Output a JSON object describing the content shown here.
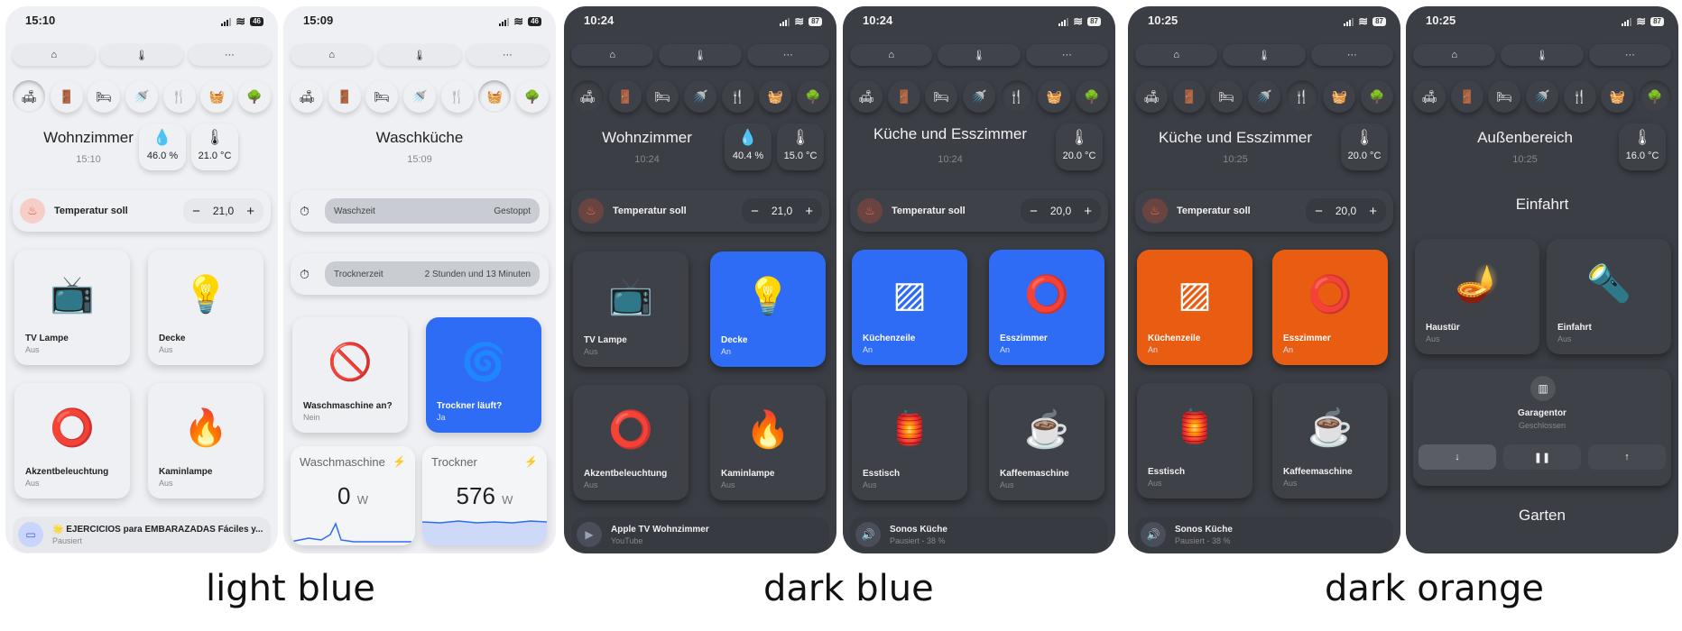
{
  "captions": {
    "light": "light blue",
    "dark_blue": "dark blue",
    "dark_orange": "dark orange"
  },
  "colors": {
    "accent_blue": "#2f6cf5",
    "accent_orange": "#e95d12",
    "light_bg": "#eef0f3",
    "dark_bg": "#3b3e45"
  },
  "nav": {
    "home_icon": "⌂",
    "thermo_icon": "🌡",
    "more_icon": "···"
  },
  "rooms_icons": [
    "sofa-icon",
    "door-icon",
    "bed-icon",
    "shower-icon",
    "cutlery-icon",
    "washer-icon",
    "tree-icon"
  ],
  "p1": {
    "time": "15:10",
    "battery": "46",
    "room": "Wohnzimmer",
    "room_time": "15:10",
    "humidity": "46.0 %",
    "temp": "21.0 °C",
    "thermo_label": "Temperatur soll",
    "thermo_value": "21,0",
    "tiles": [
      {
        "name": "TV Lampe",
        "state": "Aus"
      },
      {
        "name": "Decke",
        "state": "Aus"
      },
      {
        "name": "Akzentbeleuchtung",
        "state": "Aus"
      },
      {
        "name": "Kaminlampe",
        "state": "Aus"
      }
    ],
    "media_title": "🌟 EJERCICIOS para EMBARAZADAS Fáciles y...",
    "media_state": "Pausiert"
  },
  "p2": {
    "time": "15:09",
    "battery": "46",
    "room": "Waschküche",
    "room_time": "15:09",
    "timer1_label": "Waschzeit",
    "timer1_value": "Gestoppt",
    "timer2_label": "Trocknerzeit",
    "timer2_value": "2 Stunden und 13 Minuten",
    "tiles": [
      {
        "name": "Waschmaschine an?",
        "state": "Nein"
      },
      {
        "name": "Trockner läuft?",
        "state": "Ja"
      }
    ],
    "power": [
      {
        "name": "Waschmaschine",
        "value": "0",
        "unit": "W"
      },
      {
        "name": "Trockner",
        "value": "576",
        "unit": "W"
      }
    ]
  },
  "p3": {
    "time": "10:24",
    "battery": "87",
    "room": "Wohnzimmer",
    "room_time": "10:24",
    "humidity": "40.4 %",
    "temp": "15.0 °C",
    "thermo_label": "Temperatur soll",
    "thermo_value": "21,0",
    "tiles": [
      {
        "name": "TV Lampe",
        "state": "Aus"
      },
      {
        "name": "Decke",
        "state": "An"
      },
      {
        "name": "Akzentbeleuchtung",
        "state": "Aus"
      },
      {
        "name": "Kaminlampe",
        "state": "Aus"
      }
    ],
    "media_title": "Apple TV Wohnzimmer",
    "media_state": "YouTube"
  },
  "p4": {
    "time": "10:24",
    "battery": "87",
    "room": "Küche und Esszimmer",
    "room_time": "10:24",
    "temp": "20.0 °C",
    "thermo_label": "Temperatur soll",
    "thermo_value": "20,0",
    "tiles": [
      {
        "name": "Küchenzeile",
        "state": "An"
      },
      {
        "name": "Esszimmer",
        "state": "An"
      },
      {
        "name": "Esstisch",
        "state": "Aus"
      },
      {
        "name": "Kaffeemaschine",
        "state": "Aus"
      }
    ],
    "media_title": "Sonos Küche",
    "media_state": "Pausiert - 38 %"
  },
  "p5": {
    "time": "10:25",
    "battery": "87",
    "room": "Küche und Esszimmer",
    "room_time": "10:25",
    "temp": "20.0 °C",
    "thermo_label": "Temperatur soll",
    "thermo_value": "20,0",
    "tiles": [
      {
        "name": "Küchenzeile",
        "state": "An"
      },
      {
        "name": "Esszimmer",
        "state": "An"
      },
      {
        "name": "Esstisch",
        "state": "Aus"
      },
      {
        "name": "Kaffeemaschine",
        "state": "Aus"
      }
    ],
    "media_title": "Sonos Küche",
    "media_state": "Pausiert - 38 %"
  },
  "p6": {
    "time": "10:25",
    "battery": "87",
    "room": "Außenbereich",
    "room_time": "10:25",
    "temp": "16.0 °C",
    "section1": "Einfahrt",
    "tiles": [
      {
        "name": "Haustür",
        "state": "Aus"
      },
      {
        "name": "Einfahrt",
        "state": "Aus"
      }
    ],
    "garage_name": "Garagentor",
    "garage_state": "Geschlossen",
    "section2": "Garten"
  }
}
